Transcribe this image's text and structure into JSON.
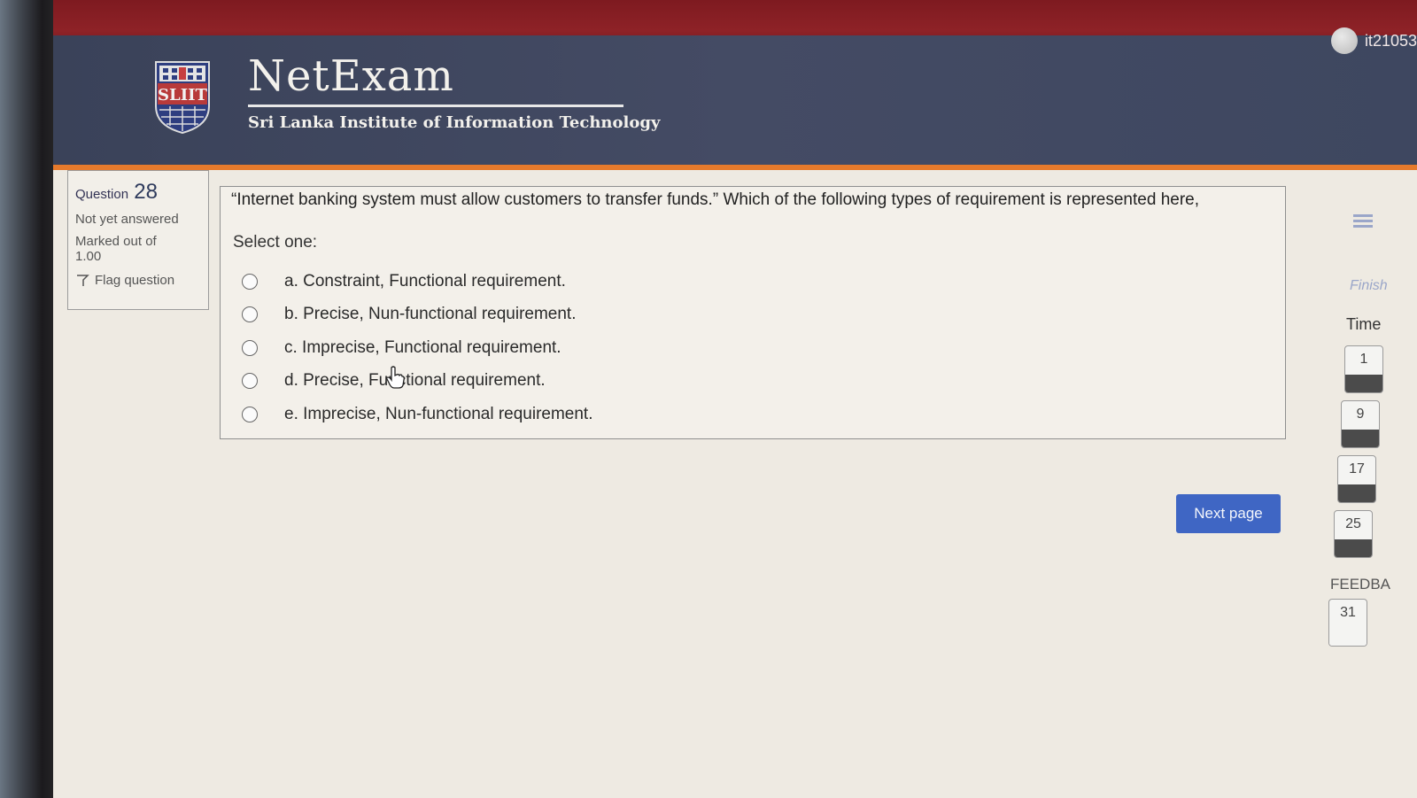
{
  "user": {
    "name": "it21053"
  },
  "brand": {
    "title": "NetExam",
    "subtitle": "Sri Lanka Institute of Information Technology",
    "logo_text": "SLIIT"
  },
  "question_info": {
    "label": "Question",
    "number": "28",
    "status": "Not yet answered",
    "marked_label": "Marked out of",
    "marked_value": "1.00",
    "flag_label": "Flag question"
  },
  "question": {
    "text": "“Internet banking system must allow customers to transfer funds.” Which of the following types of requirement is represented here,",
    "select_label": "Select one:",
    "options": [
      {
        "label": "a. Constraint, Functional requirement.",
        "selected": false
      },
      {
        "label": "b. Precise, Nun-functional requirement.",
        "selected": false
      },
      {
        "label": "c. Imprecise, Functional requirement.",
        "selected": false
      },
      {
        "label": "d. Precise, Functional requirement.",
        "selected": false
      },
      {
        "label": "e. Imprecise, Nun-functional requirement.",
        "selected": false
      }
    ]
  },
  "actions": {
    "next_label": "Next page"
  },
  "nav": {
    "finish_label": "Finish",
    "time_label": "Time",
    "feedback_label": "FEEDBA",
    "buttons": [
      "1",
      "9",
      "17",
      "25"
    ],
    "feedback_buttons": [
      "31"
    ]
  },
  "colors": {
    "topbar": "#8e2227",
    "header": "#444b64",
    "accent": "#e67a2c",
    "button": "#3f66c4"
  },
  "icons": [
    "avatar-icon",
    "sliit-logo-icon",
    "flag-icon",
    "radio-icon",
    "hand-cursor-icon",
    "menu-icon"
  ]
}
